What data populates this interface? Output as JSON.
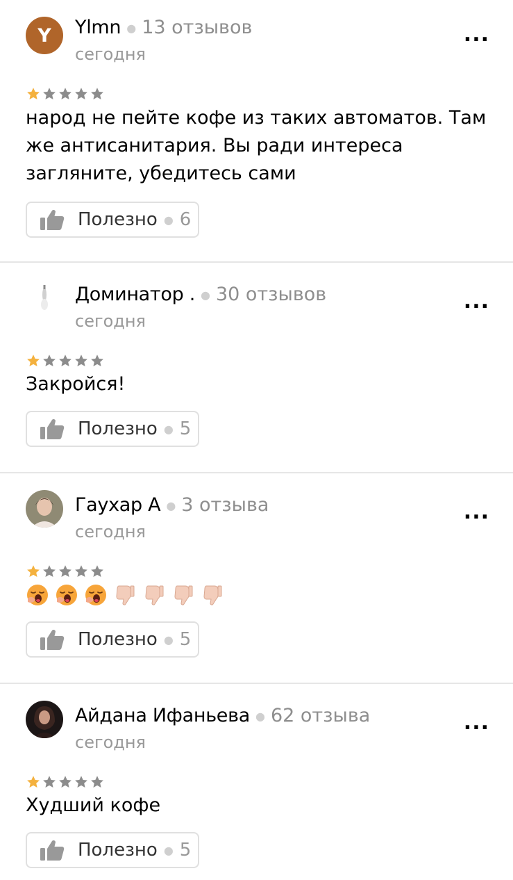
{
  "reviews": [
    {
      "author": "Ylmn",
      "avatar_letter": "Y",
      "avatar_color": "#b0652a",
      "reviews_count": "13 отзывов",
      "date": "сегодня",
      "rating": 1,
      "text": "народ не пейте кофе из таких автоматов. Там же антисанитария. Вы ради интереса загляните, убедитесь сами",
      "useful_label": "Полезно",
      "useful_count": "6",
      "more_label": "..."
    },
    {
      "author": "Доминатор .",
      "reviews_count": "30 отзывов",
      "date": "сегодня",
      "rating": 1,
      "text": "Закройся!",
      "useful_label": "Полезно",
      "useful_count": "5",
      "more_label": "..."
    },
    {
      "author": "Гаухар А",
      "reviews_count": "3 отзыва",
      "date": "сегодня",
      "rating": 1,
      "emojis": [
        "yawning-face",
        "yawning-face",
        "yawning-face",
        "thumbs-down",
        "thumbs-down",
        "thumbs-down",
        "thumbs-down"
      ],
      "useful_label": "Полезно",
      "useful_count": "5",
      "more_label": "..."
    },
    {
      "author": "Айдана Ифаньева",
      "reviews_count": "62 отзыва",
      "date": "сегодня",
      "rating": 1,
      "text": "Худший кофе",
      "useful_label": "Полезно",
      "useful_count": "5",
      "more_label": "..."
    }
  ],
  "colors": {
    "star_filled": "#f4b13e",
    "star_empty": "#8c8c8c",
    "divider": "#e6e6e6",
    "secondary_text": "#999999"
  }
}
